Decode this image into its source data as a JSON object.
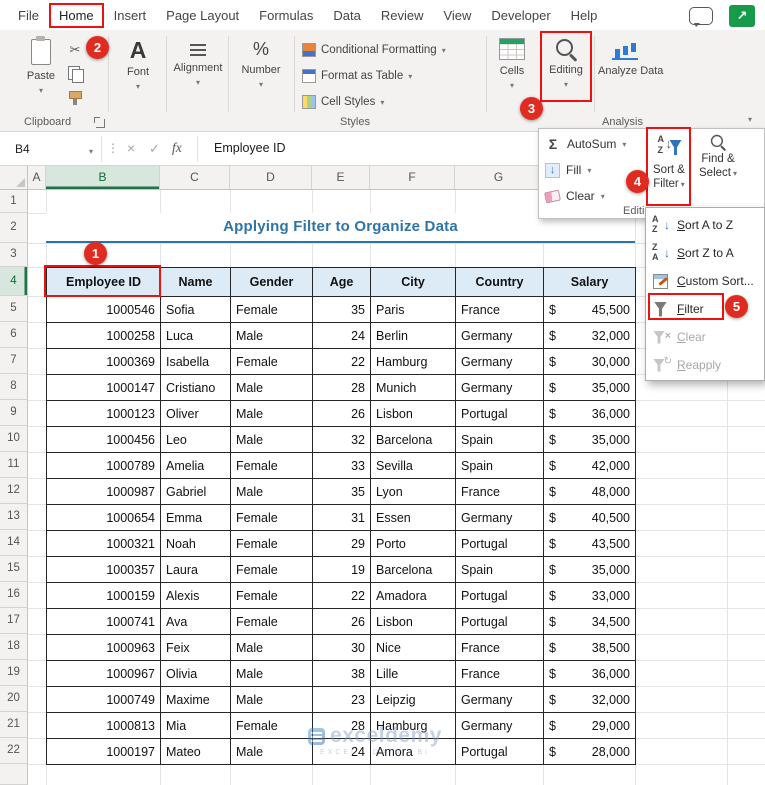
{
  "colors": {
    "annotation_red": "#EE1111",
    "selection_green": "#217346",
    "table_header_fill": "#DDEBF7",
    "title_color": "#2E74A6",
    "excel_green": "#169B4B"
  },
  "menubar": {
    "items": [
      "File",
      "Home",
      "Insert",
      "Page Layout",
      "Formulas",
      "Data",
      "Review",
      "View",
      "Developer",
      "Help"
    ],
    "active": "Home"
  },
  "ribbon": {
    "paste_label": "Paste",
    "clipboard_label": "Clipboard",
    "font_label": "Font",
    "alignment_label": "Alignment",
    "number_label": "Number",
    "styles_label": "Styles",
    "styles_items": [
      "Conditional Formatting",
      "Format as Table",
      "Cell Styles"
    ],
    "cells_label": "Cells",
    "editing_label": "Editing",
    "analyze_label": "Analyze Data",
    "analysis_label": "Analysis"
  },
  "editing_flyout": {
    "autosum_label": "AutoSum",
    "fill_label": "Fill",
    "clear_label": "Clear",
    "group_label": "Editing",
    "sort_filter_line1": "Sort &",
    "sort_filter_line2": "Filter",
    "find_select_line1": "Find &",
    "find_select_line2": "Select"
  },
  "sort_menu": {
    "items": [
      {
        "label": "Sort A to Z",
        "icon": "sort-a-to-z-icon",
        "enabled": true
      },
      {
        "label": "Sort Z to A",
        "icon": "sort-z-to-a-icon",
        "enabled": true
      },
      {
        "label": "Custom Sort...",
        "icon": "custom-sort-icon",
        "enabled": true
      },
      {
        "label": "Filter",
        "icon": "filter-icon",
        "enabled": true
      },
      {
        "label": "Clear",
        "icon": "clear-filter-icon",
        "enabled": false
      },
      {
        "label": "Reapply",
        "icon": "reapply-icon",
        "enabled": false
      }
    ]
  },
  "formula_bar": {
    "name_box": "B4",
    "fx_label": "fx",
    "content": "Employee ID"
  },
  "sheet": {
    "title": "Applying Filter to Organize Data",
    "col_letters": [
      "A",
      "B",
      "C",
      "D",
      "E",
      "F",
      "G"
    ],
    "selected_col": "B",
    "selected_row": "4",
    "row_numbers": [
      "1",
      "2",
      "3",
      "4",
      "5",
      "6",
      "7",
      "8",
      "9",
      "10",
      "11",
      "12",
      "13",
      "14",
      "15",
      "16",
      "17",
      "18",
      "19",
      "20",
      "21",
      "22"
    ],
    "table": {
      "currency": "$",
      "headers": [
        "Employee ID",
        "Name",
        "Gender",
        "Age",
        "City",
        "Country",
        "Salary"
      ],
      "rows": [
        {
          "id": "1000546",
          "name": "Sofia",
          "gender": "Female",
          "age": "35",
          "city": "Paris",
          "country": "France",
          "salary": "45,500"
        },
        {
          "id": "1000258",
          "name": "Luca",
          "gender": "Male",
          "age": "24",
          "city": "Berlin",
          "country": "Germany",
          "salary": "32,000"
        },
        {
          "id": "1000369",
          "name": "Isabella",
          "gender": "Female",
          "age": "22",
          "city": "Hamburg",
          "country": "Germany",
          "salary": "30,000"
        },
        {
          "id": "1000147",
          "name": "Cristiano",
          "gender": "Male",
          "age": "28",
          "city": "Munich",
          "country": "Germany",
          "salary": "35,000"
        },
        {
          "id": "1000123",
          "name": "Oliver",
          "gender": "Male",
          "age": "26",
          "city": "Lisbon",
          "country": "Portugal",
          "salary": "36,000"
        },
        {
          "id": "1000456",
          "name": "Leo",
          "gender": "Male",
          "age": "32",
          "city": "Barcelona",
          "country": "Spain",
          "salary": "35,000"
        },
        {
          "id": "1000789",
          "name": "Amelia",
          "gender": "Female",
          "age": "33",
          "city": "Sevilla",
          "country": "Spain",
          "salary": "42,000"
        },
        {
          "id": "1000987",
          "name": "Gabriel",
          "gender": "Male",
          "age": "35",
          "city": "Lyon",
          "country": "France",
          "salary": "48,000"
        },
        {
          "id": "1000654",
          "name": "Emma",
          "gender": "Female",
          "age": "31",
          "city": "Essen",
          "country": "Germany",
          "salary": "40,500"
        },
        {
          "id": "1000321",
          "name": "Noah",
          "gender": "Female",
          "age": "29",
          "city": "Porto",
          "country": "Portugal",
          "salary": "43,500"
        },
        {
          "id": "1000357",
          "name": "Laura",
          "gender": "Female",
          "age": "19",
          "city": "Barcelona",
          "country": "Spain",
          "salary": "35,000"
        },
        {
          "id": "1000159",
          "name": "Alexis",
          "gender": "Female",
          "age": "22",
          "city": "Amadora",
          "country": "Portugal",
          "salary": "33,000"
        },
        {
          "id": "1000741",
          "name": "Ava",
          "gender": "Female",
          "age": "26",
          "city": "Lisbon",
          "country": "Portugal",
          "salary": "34,500"
        },
        {
          "id": "1000963",
          "name": "Feix",
          "gender": "Male",
          "age": "30",
          "city": "Nice",
          "country": "France",
          "salary": "38,500"
        },
        {
          "id": "1000967",
          "name": "Olivia",
          "gender": "Male",
          "age": "38",
          "city": "Lille",
          "country": "France",
          "salary": "36,000"
        },
        {
          "id": "1000749",
          "name": "Maxime",
          "gender": "Male",
          "age": "23",
          "city": "Leipzig",
          "country": "Germany",
          "salary": "32,000"
        },
        {
          "id": "1000813",
          "name": "Mia",
          "gender": "Female",
          "age": "28",
          "city": "Hamburg",
          "country": "Germany",
          "salary": "29,000"
        },
        {
          "id": "1000197",
          "name": "Mateo",
          "gender": "Male",
          "age": "24",
          "city": "Amora",
          "country": "Portugal",
          "salary": "28,000"
        }
      ]
    }
  },
  "watermark": {
    "text": "exceldemy",
    "subtext": "EXCEL · DATA · BI"
  },
  "annotations": {
    "steps": [
      "1",
      "2",
      "3",
      "4",
      "5"
    ]
  },
  "icons": {
    "cut": "✂",
    "font_letter": "A",
    "percent": "%",
    "sigma": "Σ",
    "down_arrow": "↓",
    "cancel": "×",
    "enter": "✓",
    "dots": "⋮",
    "share_arrow": "↗"
  }
}
